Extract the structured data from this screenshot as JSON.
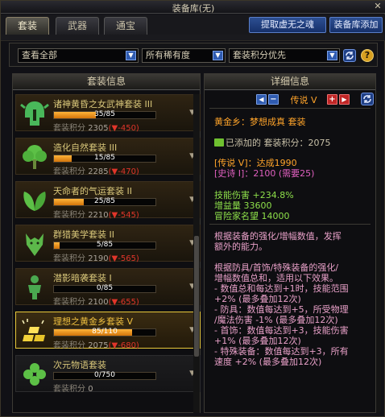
{
  "window": {
    "title": "装备库(无)",
    "close_label": "✕"
  },
  "tabs": [
    {
      "label": "套装",
      "active": true
    },
    {
      "label": "武器",
      "active": false
    },
    {
      "label": "通宝",
      "active": false
    }
  ],
  "buttons": {
    "extract": "提取虚无之魂",
    "add": "装备库添加"
  },
  "filters": {
    "category": "查看全部",
    "rarity": "所有稀有度",
    "sort": "套装积分优先",
    "refresh_icon": "refresh-icon",
    "help_label": "?"
  },
  "left_panel": {
    "header": "套装信息",
    "score_label": "套装积分",
    "items": [
      {
        "name": "诸神黄昏之女武神套装 III",
        "progress": "35/85",
        "progress_value": 35,
        "progress_max": 85,
        "score": "2305",
        "delta": "(▼-450)",
        "icon": "valkyrie-helmet-icon",
        "selected": false
      },
      {
        "name": "造化自然套装 III",
        "progress": "15/85",
        "progress_value": 15,
        "progress_max": 85,
        "score": "2285",
        "delta": "(▼-470)",
        "icon": "tree-icon",
        "selected": false
      },
      {
        "name": "天命者的气运套装 II",
        "progress": "25/85",
        "progress_value": 25,
        "progress_max": 85,
        "score": "2210",
        "delta": "(▼-545)",
        "icon": "leaf-icon",
        "selected": false
      },
      {
        "name": "群猎美学套装 II",
        "progress": "5/85",
        "progress_value": 5,
        "progress_max": 85,
        "score": "2190",
        "delta": "(▼-565)",
        "icon": "wolf-icon",
        "selected": false
      },
      {
        "name": "潜影暗袭套装 I",
        "progress": "0/85",
        "progress_value": 0,
        "progress_max": 85,
        "score": "2100",
        "delta": "(▼-655)",
        "icon": "shadow-figure-icon",
        "selected": false
      },
      {
        "name": "理想之黄金乡套装 V",
        "progress": "85/110",
        "progress_value": 85,
        "progress_max": 110,
        "score": "2075",
        "delta": "(▼-680)",
        "icon": "gold-bars-icon",
        "selected": true
      },
      {
        "name": "次元物语套装",
        "progress": "0/750",
        "progress_value": 0,
        "progress_max": 750,
        "score": "0",
        "delta": "",
        "icon": "clover-icon",
        "selected": false
      }
    ]
  },
  "right_panel": {
    "header": "详细信息",
    "grade": "传说 V",
    "set_title": "黄金乡：梦想成真  套装",
    "added_text": "已添加的 套装积分：",
    "added_score": "2075",
    "req1": "[传说 V]：达成1990",
    "req2": "[史诗 I]：2100 (需要25)",
    "stats": [
      "技能伤害 +234.8%",
      "增益量 33600",
      "冒险家名望 14000"
    ],
    "desc1": [
      "根据装备的强化/增幅数值，发挥",
      "额外的能力。"
    ],
    "desc2": [
      "根据防具/首饰/特殊装备的强化/",
      "增幅数值总和，适用以下效果。",
      "- 数值总和每达到+1时，技能范围",
      "+2% (最多叠加12次)",
      "- 防具：数值每达到+5，所受物理",
      "/魔法伤害 -1% (最多叠加12次)",
      "- 首饰：数值每达到+3，技能伤害",
      "+1% (最多叠加12次)",
      "- 特殊装备：数值每达到+3，所有",
      "速度 +2% (最多叠加12次)"
    ]
  },
  "colors": {
    "accent_gold": "#e8c83a",
    "score_delta": "#e0352a",
    "legend_orange": "#ffa42a",
    "epic_pink": "#e060c0",
    "stat_green": "#8ee04a",
    "desc_pink": "#e8a0c8",
    "button_blue": "#2d4f92"
  }
}
